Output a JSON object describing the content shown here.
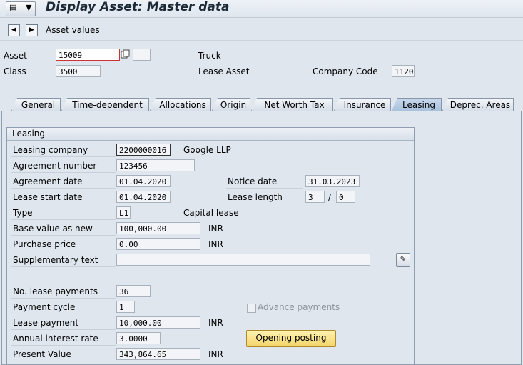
{
  "window": {
    "title": "Display Asset:  Master data"
  },
  "toolbar": {
    "asset_values_label": "Asset values"
  },
  "header": {
    "asset_label": "Asset",
    "asset_value": "15009",
    "sub_number": "",
    "asset_description": "Truck",
    "class_label": "Class",
    "class_value": "3500",
    "class_description": "Lease Asset",
    "company_code_label": "Company Code",
    "company_code_value": "1120"
  },
  "tabs": [
    {
      "label": "General"
    },
    {
      "label": "Time-dependent"
    },
    {
      "label": "Allocations"
    },
    {
      "label": "Origin"
    },
    {
      "label": "Net Worth Tax"
    },
    {
      "label": "Insurance"
    },
    {
      "label": "Leasing",
      "active": true
    },
    {
      "label": "Deprec. Areas"
    }
  ],
  "leasing": {
    "group_title": "Leasing",
    "leasing_company_label": "Leasing company",
    "leasing_company_value": "2200000016",
    "leasing_company_name": "Google LLP",
    "agreement_number_label": "Agreement number",
    "agreement_number_value": "123456",
    "agreement_date_label": "Agreement date",
    "agreement_date_value": "01.04.2020",
    "notice_date_label": "Notice date",
    "notice_date_value": "31.03.2023",
    "lease_start_label": "Lease start date",
    "lease_start_value": "01.04.2020",
    "lease_length_label": "Lease length",
    "lease_length_years": "3",
    "lease_length_sep": "/",
    "lease_length_periods": "0",
    "type_label": "Type",
    "type_value": "L1",
    "type_description": "Capital lease",
    "base_value_label": "Base value as new",
    "base_value_value": "100,000.00",
    "base_value_currency": "INR",
    "purchase_price_label": "Purchase price",
    "purchase_price_value": "0.00",
    "purchase_price_currency": "INR",
    "supp_text_label": "Supplementary text",
    "supp_text_value": "",
    "num_payments_label": "No. lease payments",
    "num_payments_value": "36",
    "payment_cycle_label": "Payment cycle",
    "payment_cycle_value": "1",
    "advance_payments_label": "Advance payments",
    "lease_payment_label": "Lease payment",
    "lease_payment_value": "10,000.00",
    "lease_payment_currency": "INR",
    "interest_rate_label": "Annual interest rate",
    "interest_rate_value": "3.0000",
    "opening_posting_label": "Opening posting",
    "present_value_label": "Present Value",
    "present_value_value": "343,864.65",
    "present_value_currency": "INR"
  }
}
